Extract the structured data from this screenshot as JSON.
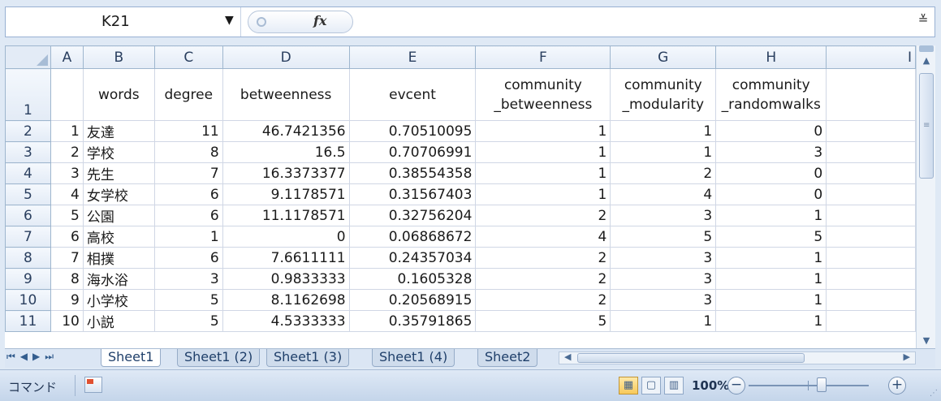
{
  "formula_bar": {
    "name_box": "K21",
    "fx_label": "fx",
    "formula": ""
  },
  "columns": [
    "A",
    "B",
    "C",
    "D",
    "E",
    "F",
    "G",
    "H",
    "I"
  ],
  "header_row": {
    "row_num": "1",
    "A": "",
    "B": "words",
    "C": "degree",
    "D": "betweenness",
    "E": "evcent",
    "F1": "community",
    "F2": "_betweenness",
    "G1": "community",
    "G2": "_modularity",
    "H1": "community",
    "H2": "_randomwalks"
  },
  "rows": [
    {
      "n": "2",
      "a": "1",
      "word": "友達",
      "degree": "11",
      "betweenness": "46.7421356",
      "evcent": "0.70510095",
      "cb": "1",
      "cm": "1",
      "cr": "0"
    },
    {
      "n": "3",
      "a": "2",
      "word": "学校",
      "degree": "8",
      "betweenness": "16.5",
      "evcent": "0.70706991",
      "cb": "1",
      "cm": "1",
      "cr": "3"
    },
    {
      "n": "4",
      "a": "3",
      "word": "先生",
      "degree": "7",
      "betweenness": "16.3373377",
      "evcent": "0.38554358",
      "cb": "1",
      "cm": "2",
      "cr": "0"
    },
    {
      "n": "5",
      "a": "4",
      "word": "女学校",
      "degree": "6",
      "betweenness": "9.1178571",
      "evcent": "0.31567403",
      "cb": "1",
      "cm": "4",
      "cr": "0"
    },
    {
      "n": "6",
      "a": "5",
      "word": "公園",
      "degree": "6",
      "betweenness": "11.1178571",
      "evcent": "0.32756204",
      "cb": "2",
      "cm": "3",
      "cr": "1"
    },
    {
      "n": "7",
      "a": "6",
      "word": "高校",
      "degree": "1",
      "betweenness": "0",
      "evcent": "0.06868672",
      "cb": "4",
      "cm": "5",
      "cr": "5"
    },
    {
      "n": "8",
      "a": "7",
      "word": "相撲",
      "degree": "6",
      "betweenness": "7.6611111",
      "evcent": "0.24357034",
      "cb": "2",
      "cm": "3",
      "cr": "1"
    },
    {
      "n": "9",
      "a": "8",
      "word": "海水浴",
      "degree": "3",
      "betweenness": "0.9833333",
      "evcent": "0.1605328",
      "cb": "2",
      "cm": "3",
      "cr": "1"
    },
    {
      "n": "10",
      "a": "9",
      "word": "小学校",
      "degree": "5",
      "betweenness": "8.1162698",
      "evcent": "0.20568915",
      "cb": "2",
      "cm": "3",
      "cr": "1"
    },
    {
      "n": "11",
      "a": "10",
      "word": "小説",
      "degree": "5",
      "betweenness": "4.5333333",
      "evcent": "0.35791865",
      "cb": "5",
      "cm": "1",
      "cr": "1"
    }
  ],
  "sheet_tabs": [
    "Sheet1",
    "Sheet1 (2)",
    "Sheet1 (3)",
    "Sheet1 (4)",
    "Sheet2"
  ],
  "status_bar": {
    "mode": "コマンド",
    "zoom": "100%"
  }
}
